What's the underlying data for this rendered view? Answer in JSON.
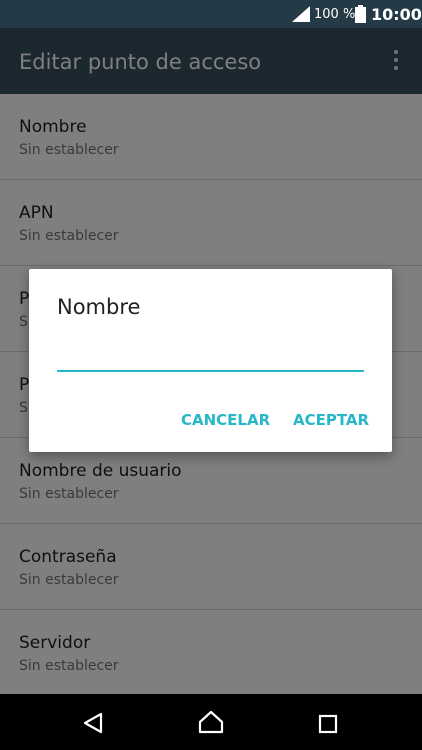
{
  "status_bar": {
    "signal_icon": "signal-bars-icon",
    "battery_percent": "100 %",
    "battery_icon": "battery-full-icon",
    "time": "10:00"
  },
  "app_bar": {
    "title": "Editar punto de acceso",
    "menu_icon": "overflow-menu-icon"
  },
  "list": {
    "items": [
      {
        "title": "Nombre",
        "subtitle": "Sin establecer"
      },
      {
        "title": "APN",
        "subtitle": "Sin establecer"
      },
      {
        "title": "P",
        "subtitle": "S"
      },
      {
        "title": "P",
        "subtitle": "S"
      },
      {
        "title": "Nombre de usuario",
        "subtitle": "Sin establecer"
      },
      {
        "title": "Contraseña",
        "subtitle": "Sin establecer"
      },
      {
        "title": "Servidor",
        "subtitle": "Sin establecer"
      }
    ]
  },
  "dialog": {
    "title": "Nombre",
    "input_value": "",
    "cancel_label": "CANCELAR",
    "ok_label": "ACEPTAR"
  },
  "nav_bar": {
    "back_icon": "back-triangle-icon",
    "home_icon": "home-icon",
    "recents_icon": "recents-square-icon"
  },
  "colors": {
    "status_bar": "#243a47",
    "app_bar": "#37505f",
    "accent": "#26b8c8"
  }
}
